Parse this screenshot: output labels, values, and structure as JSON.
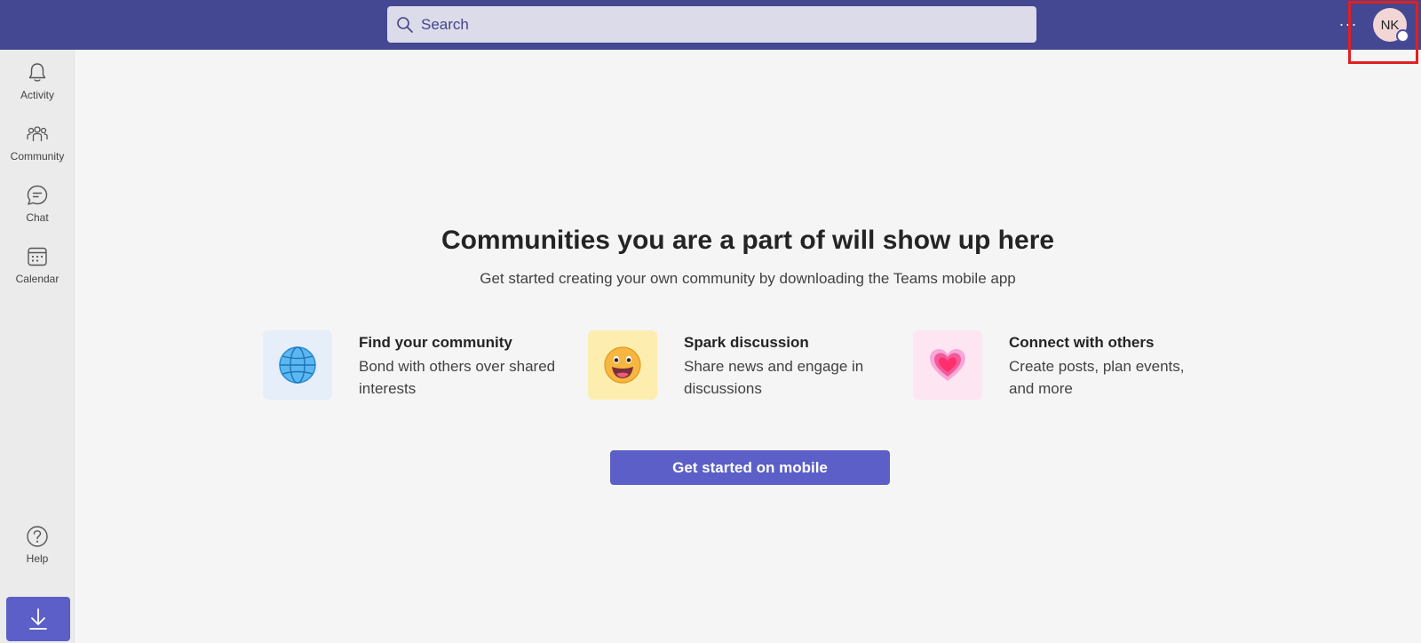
{
  "header": {
    "search_placeholder": "Search",
    "more_label": "···",
    "avatar_initials": "NK"
  },
  "rail": {
    "items": [
      {
        "label": "Activity",
        "icon": "bell-icon"
      },
      {
        "label": "Community",
        "icon": "community-icon"
      },
      {
        "label": "Chat",
        "icon": "chat-icon"
      },
      {
        "label": "Calendar",
        "icon": "calendar-icon"
      }
    ],
    "help_label": "Help",
    "download_icon": "download-icon"
  },
  "main": {
    "title": "Communities you are a part of will show up here",
    "subtitle": "Get started creating your own community by downloading the Teams mobile app",
    "features": [
      {
        "title": "Find your community",
        "desc": "Bond with others over shared interests",
        "icon": "globe-icon"
      },
      {
        "title": "Spark discussion",
        "desc": "Share news and engage in discussions",
        "icon": "smile-emoji-icon"
      },
      {
        "title": "Connect with others",
        "desc": "Create posts, plan events, and more",
        "icon": "heart-icon"
      }
    ],
    "cta_label": "Get started on mobile"
  },
  "colors": {
    "topbar": "#444791",
    "accent": "#5b5fc7",
    "highlight_border": "#e02020"
  }
}
